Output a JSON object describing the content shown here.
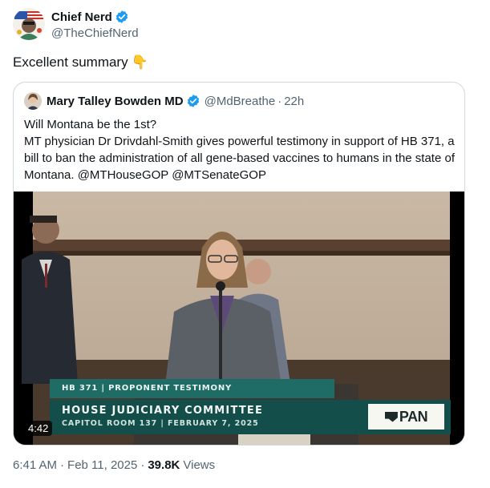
{
  "tweet": {
    "author": {
      "display_name": "Chief Nerd",
      "handle": "@TheChiefNerd",
      "verified_icon": "verified-badge-icon"
    },
    "text": "Excellent summary",
    "emoji": "👇",
    "quoted": {
      "author": {
        "display_name": "Mary Talley Bowden MD",
        "handle": "@MdBreathe",
        "time": "22h",
        "separator": "·"
      },
      "lines": [
        "Will Montana be the 1st?",
        "MT physician Dr Drivdahl-Smith gives powerful testimony in support of HB 371, a bill to ban the administration of all gene-based vaccines to humans in the state of Montana. @MTHouseGOP @MTSenateGOP"
      ],
      "video": {
        "duration": "4:42",
        "lower_third_top": "HB 371 | PROPONENT TESTIMONY",
        "lower_third_title": "HOUSE JUDICIARY COMMITTEE",
        "lower_third_sub": "CAPITOL ROOM 137 | FEBRUARY 7, 2025",
        "network_logo": "PAN"
      }
    },
    "meta": {
      "time": "6:41 AM",
      "date": "Feb 11, 2025",
      "separator": "·",
      "views_count": "39.8K",
      "views_label": "Views"
    }
  },
  "colors": {
    "accent_verified": "#1d9bf0",
    "secondary_text": "#536471",
    "border": "#cfd9de",
    "banner_teal": "#134e4a"
  }
}
